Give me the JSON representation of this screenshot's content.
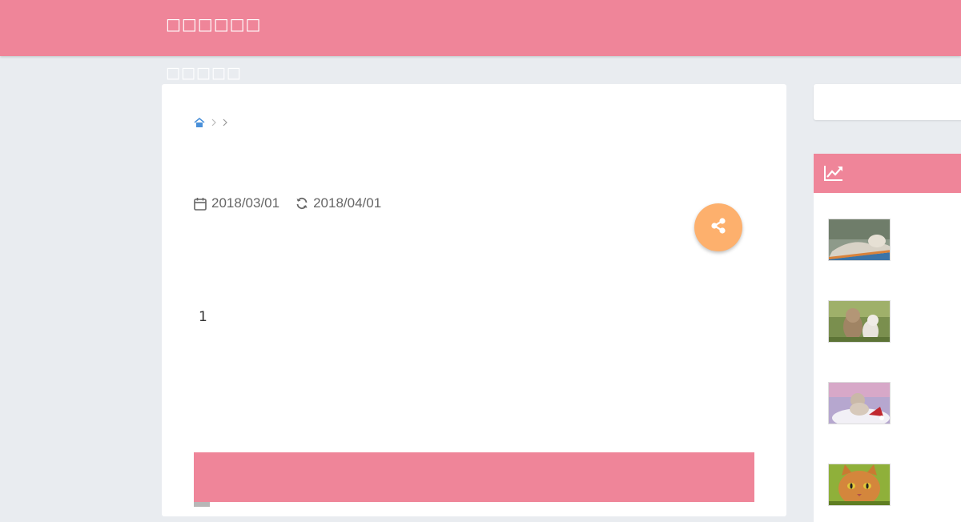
{
  "header": {
    "site_title": "□□□□□□",
    "subtitle": "□□□□□",
    "accent_color": "#ef8599"
  },
  "breadcrumb": {
    "home_icon": "home-icon",
    "separator_icon": "chevron-right-icon"
  },
  "article": {
    "published_date": "2018/03/01",
    "updated_date": "2018/04/01",
    "published_icon": "calendar-icon",
    "updated_icon": "refresh-icon",
    "body_text": "1",
    "share_icon": "share-icon",
    "share_color": "#fdb06d"
  },
  "sidebar": {
    "widget_icon": "trending-chart-icon",
    "thumbnails": [
      {
        "subject": "cat-on-branch"
      },
      {
        "subject": "kittens-in-grass"
      },
      {
        "subject": "kitten-with-santa-hat"
      },
      {
        "subject": "tabby-cat-close-up"
      }
    ]
  }
}
